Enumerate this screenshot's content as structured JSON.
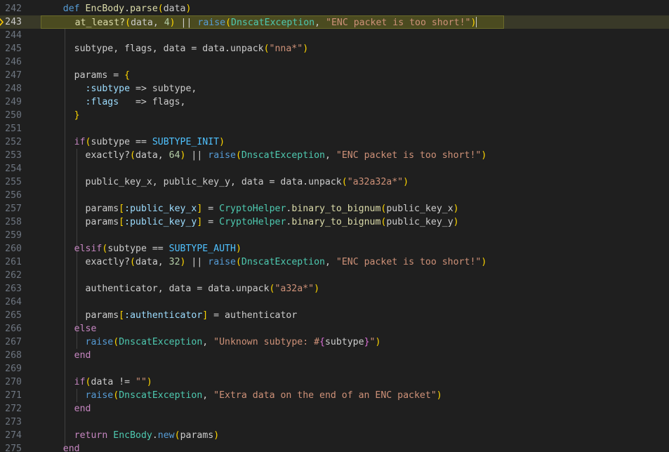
{
  "editor": {
    "current_line": "243",
    "lines": [
      {
        "num": "242",
        "tokens": [
          {
            "t": "def",
            "c": "kw"
          },
          {
            "t": " "
          },
          {
            "t": "EncBody",
            "c": "fn"
          },
          {
            "t": "."
          },
          {
            "t": "parse",
            "c": "fn"
          },
          {
            "t": "(",
            "c": "br1"
          },
          {
            "t": "data"
          },
          {
            "t": ")",
            "c": "br1"
          }
        ]
      },
      {
        "num": "243",
        "tokens": [
          {
            "t": "  at_least?",
            "c": "fn"
          },
          {
            "t": "(",
            "c": "br1"
          },
          {
            "t": "data, "
          },
          {
            "t": "4",
            "c": "num"
          },
          {
            "t": ") ",
            "c": "br1"
          },
          {
            "t": "|| "
          },
          {
            "t": "raise",
            "c": "meth2"
          },
          {
            "t": "(",
            "c": "br1"
          },
          {
            "t": "DnscatException",
            "c": "cls"
          },
          {
            "t": ", "
          },
          {
            "t": "\"ENC packet is too short!\"",
            "c": "str"
          },
          {
            "t": ")",
            "c": "br1"
          }
        ]
      },
      {
        "num": "244",
        "tokens": []
      },
      {
        "num": "245",
        "tokens": [
          {
            "t": "  subtype, flags, data = data.unpack"
          },
          {
            "t": "(",
            "c": "br1"
          },
          {
            "t": "\"nna*\"",
            "c": "str"
          },
          {
            "t": ")",
            "c": "br1"
          }
        ]
      },
      {
        "num": "246",
        "tokens": []
      },
      {
        "num": "247",
        "tokens": [
          {
            "t": "  params = "
          },
          {
            "t": "{",
            "c": "br1"
          }
        ]
      },
      {
        "num": "248",
        "tokens": [
          {
            "t": "    "
          },
          {
            "t": ":subtype",
            "c": "sym"
          },
          {
            "t": " => subtype,"
          }
        ]
      },
      {
        "num": "249",
        "tokens": [
          {
            "t": "    "
          },
          {
            "t": ":flags",
            "c": "sym"
          },
          {
            "t": "   => flags,"
          }
        ]
      },
      {
        "num": "250",
        "tokens": [
          {
            "t": "  "
          },
          {
            "t": "}",
            "c": "br1"
          }
        ]
      },
      {
        "num": "251",
        "tokens": []
      },
      {
        "num": "252",
        "tokens": [
          {
            "t": "  "
          },
          {
            "t": "if",
            "c": "ctl"
          },
          {
            "t": "(",
            "c": "br1"
          },
          {
            "t": "subtype == "
          },
          {
            "t": "SUBTYPE_INIT",
            "c": "const"
          },
          {
            "t": ")",
            "c": "br1"
          }
        ]
      },
      {
        "num": "253",
        "tokens": [
          {
            "t": "    exactly?"
          },
          {
            "t": "(",
            "c": "br1"
          },
          {
            "t": "data, "
          },
          {
            "t": "64",
            "c": "num"
          },
          {
            "t": ")",
            "c": "br1"
          },
          {
            "t": " || "
          },
          {
            "t": "raise",
            "c": "meth2"
          },
          {
            "t": "(",
            "c": "br1"
          },
          {
            "t": "DnscatException",
            "c": "cls"
          },
          {
            "t": ", "
          },
          {
            "t": "\"ENC packet is too short!\"",
            "c": "str"
          },
          {
            "t": ")",
            "c": "br1"
          }
        ]
      },
      {
        "num": "254",
        "tokens": []
      },
      {
        "num": "255",
        "tokens": [
          {
            "t": "    public_key_x, public_key_y, data = data.unpack"
          },
          {
            "t": "(",
            "c": "br1"
          },
          {
            "t": "\"a32a32a*\"",
            "c": "str"
          },
          {
            "t": ")",
            "c": "br1"
          }
        ]
      },
      {
        "num": "256",
        "tokens": []
      },
      {
        "num": "257",
        "tokens": [
          {
            "t": "    params"
          },
          {
            "t": "[",
            "c": "br1"
          },
          {
            "t": ":public_key_x",
            "c": "sym"
          },
          {
            "t": "]",
            "c": "br1"
          },
          {
            "t": " = "
          },
          {
            "t": "CryptoHelper",
            "c": "cls"
          },
          {
            "t": "."
          },
          {
            "t": "binary_to_bignum",
            "c": "fn"
          },
          {
            "t": "(",
            "c": "br1"
          },
          {
            "t": "public_key_x"
          },
          {
            "t": ")",
            "c": "br1"
          }
        ]
      },
      {
        "num": "258",
        "tokens": [
          {
            "t": "    params"
          },
          {
            "t": "[",
            "c": "br1"
          },
          {
            "t": ":public_key_y",
            "c": "sym"
          },
          {
            "t": "]",
            "c": "br1"
          },
          {
            "t": " = "
          },
          {
            "t": "CryptoHelper",
            "c": "cls"
          },
          {
            "t": "."
          },
          {
            "t": "binary_to_bignum",
            "c": "fn"
          },
          {
            "t": "(",
            "c": "br1"
          },
          {
            "t": "public_key_y"
          },
          {
            "t": ")",
            "c": "br1"
          }
        ]
      },
      {
        "num": "259",
        "tokens": []
      },
      {
        "num": "260",
        "tokens": [
          {
            "t": "  "
          },
          {
            "t": "elsif",
            "c": "ctl"
          },
          {
            "t": "(",
            "c": "br1"
          },
          {
            "t": "subtype == "
          },
          {
            "t": "SUBTYPE_AUTH",
            "c": "const"
          },
          {
            "t": ")",
            "c": "br1"
          }
        ]
      },
      {
        "num": "261",
        "tokens": [
          {
            "t": "    exactly?"
          },
          {
            "t": "(",
            "c": "br1"
          },
          {
            "t": "data, "
          },
          {
            "t": "32",
            "c": "num"
          },
          {
            "t": ")",
            "c": "br1"
          },
          {
            "t": " || "
          },
          {
            "t": "raise",
            "c": "meth2"
          },
          {
            "t": "(",
            "c": "br1"
          },
          {
            "t": "DnscatException",
            "c": "cls"
          },
          {
            "t": ", "
          },
          {
            "t": "\"ENC packet is too short!\"",
            "c": "str"
          },
          {
            "t": ")",
            "c": "br1"
          }
        ]
      },
      {
        "num": "262",
        "tokens": []
      },
      {
        "num": "263",
        "tokens": [
          {
            "t": "    authenticator, data = data.unpack"
          },
          {
            "t": "(",
            "c": "br1"
          },
          {
            "t": "\"a32a*\"",
            "c": "str"
          },
          {
            "t": ")",
            "c": "br1"
          }
        ]
      },
      {
        "num": "264",
        "tokens": []
      },
      {
        "num": "265",
        "tokens": [
          {
            "t": "    params"
          },
          {
            "t": "[",
            "c": "br1"
          },
          {
            "t": ":authenticator",
            "c": "sym"
          },
          {
            "t": "]",
            "c": "br1"
          },
          {
            "t": " = authenticator"
          }
        ]
      },
      {
        "num": "266",
        "tokens": [
          {
            "t": "  "
          },
          {
            "t": "else",
            "c": "ctl"
          }
        ]
      },
      {
        "num": "267",
        "tokens": [
          {
            "t": "    "
          },
          {
            "t": "raise",
            "c": "meth2"
          },
          {
            "t": "(",
            "c": "br1"
          },
          {
            "t": "DnscatException",
            "c": "cls"
          },
          {
            "t": ", "
          },
          {
            "t": "\"Unknown subtype: #",
            "c": "str"
          },
          {
            "t": "{",
            "c": "br2"
          },
          {
            "t": "subtype"
          },
          {
            "t": "}",
            "c": "br2"
          },
          {
            "t": "\"",
            "c": "str"
          },
          {
            "t": ")",
            "c": "br1"
          }
        ]
      },
      {
        "num": "268",
        "tokens": [
          {
            "t": "  "
          },
          {
            "t": "end",
            "c": "ctl"
          }
        ]
      },
      {
        "num": "269",
        "tokens": []
      },
      {
        "num": "270",
        "tokens": [
          {
            "t": "  "
          },
          {
            "t": "if",
            "c": "ctl"
          },
          {
            "t": "(",
            "c": "br1"
          },
          {
            "t": "data != "
          },
          {
            "t": "\"\"",
            "c": "str"
          },
          {
            "t": ")",
            "c": "br1"
          }
        ]
      },
      {
        "num": "271",
        "tokens": [
          {
            "t": "    "
          },
          {
            "t": "raise",
            "c": "meth2"
          },
          {
            "t": "(",
            "c": "br1"
          },
          {
            "t": "DnscatException",
            "c": "cls"
          },
          {
            "t": ", "
          },
          {
            "t": "\"Extra data on the end of an ENC packet\"",
            "c": "str"
          },
          {
            "t": ")",
            "c": "br1"
          }
        ]
      },
      {
        "num": "272",
        "tokens": [
          {
            "t": "  "
          },
          {
            "t": "end",
            "c": "ctl"
          }
        ]
      },
      {
        "num": "273",
        "tokens": []
      },
      {
        "num": "274",
        "tokens": [
          {
            "t": "  "
          },
          {
            "t": "return",
            "c": "ctl"
          },
          {
            "t": " "
          },
          {
            "t": "EncBody",
            "c": "cls"
          },
          {
            "t": "."
          },
          {
            "t": "new",
            "c": "meth2"
          },
          {
            "t": "(",
            "c": "br1"
          },
          {
            "t": "params"
          },
          {
            "t": ")",
            "c": "br1"
          }
        ]
      },
      {
        "num": "275",
        "tokens": [
          {
            "t": "end",
            "c": "ctl"
          }
        ]
      }
    ]
  },
  "colors": {
    "background": "#1f1f1f",
    "current_line": "#393928",
    "breakpoint_arrow": "#ffcc00"
  }
}
